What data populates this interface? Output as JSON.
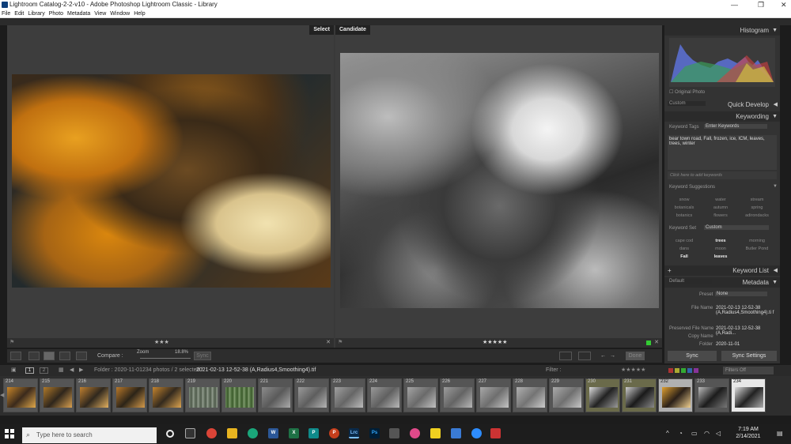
{
  "window": {
    "title": "Lightroom Catalog-2-2-v10 - Adobe Photoshop Lightroom Classic - Library",
    "min": "—",
    "max": "❐",
    "close": "✕"
  },
  "menu": [
    "File",
    "Edit",
    "Library",
    "Photo",
    "Metadata",
    "View",
    "Window",
    "Help"
  ],
  "compare": {
    "select_label": "Select",
    "candidate_label": "Candidate",
    "select_stars": "★★★",
    "candidate_stars": "★★★★★",
    "close": "✕"
  },
  "toolbar": {
    "compare_label": "Compare :",
    "zoom_label": "Zoom",
    "zoom_value": "18.8%",
    "sync_label": "Sync",
    "done_label": "Done"
  },
  "right_panel": {
    "histogram": "Histogram",
    "original_photo": "Original Photo",
    "preset_custom": "Custom",
    "quick_develop": "Quick Develop",
    "keywording": "Keywording",
    "keyword_tags_label": "Keyword Tags",
    "keyword_tags_mode": "Enter Keywords",
    "keywords_text": "bear town road, Fall, frozen, ice, ICM, leaves, trees, winter",
    "add_keywords": "Click here to add keywords",
    "suggestions_label": "Keyword Suggestions",
    "suggestions": [
      "snow",
      "water",
      "stream",
      "botanicals",
      "autumn",
      "spring",
      "botanics",
      "flowers",
      "adirondacks"
    ],
    "keyword_set_label": "Keyword Set",
    "keyword_set_value": "Custom",
    "set_keywords": [
      "cape cod",
      "trees",
      "morning",
      "dans",
      "moon",
      "Butler Pond",
      "Fall",
      "leaves",
      ""
    ],
    "keyword_list": "Keyword List",
    "metadata_preset": "Default",
    "metadata": "Metadata",
    "preset_label": "Preset",
    "preset_value": "None",
    "file_name_label": "File Name",
    "file_name_value": "2021-02-13 12-52-38 (A,Radius4,Smoothing4).ti f",
    "preserved_label": "Preserved File Name",
    "preserved_value": "2021-02-13 12-52-38 (A,Radi...",
    "copy_name_label": "Copy Name",
    "folder_label": "Folder",
    "folder_value": "2020-11-01",
    "sync_btn": "Sync",
    "sync_settings_btn": "Sync Settings"
  },
  "filmstrip_bar": {
    "page1": "1",
    "page2": "2",
    "source": "Folder : 2020-11-01",
    "count": "234 photos / 2 selected /",
    "filename": "2021-02-13 12-52-38 (A,Radius4,Smoothing4).tif",
    "filter_label": "Filter :",
    "filters_off": "Filters Off"
  },
  "filmstrip": [
    "214",
    "215",
    "216",
    "217",
    "218",
    "219",
    "220",
    "221",
    "222",
    "223",
    "224",
    "225",
    "226",
    "227",
    "228",
    "229",
    "230",
    "231",
    "232",
    "233",
    "234"
  ],
  "taskbar": {
    "search_placeholder": "Type here to search",
    "time": "7:19 AM",
    "date": "2/14/2021"
  }
}
